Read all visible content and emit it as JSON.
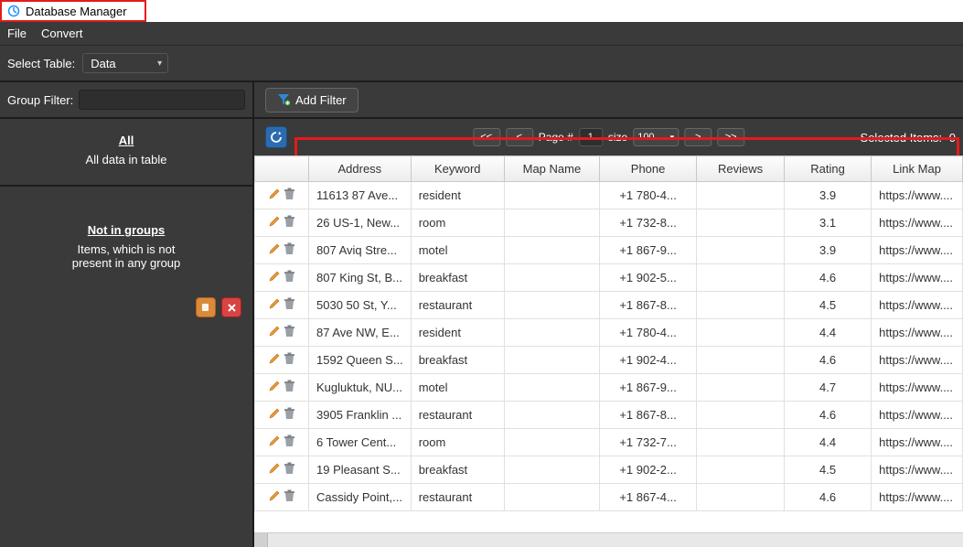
{
  "window": {
    "title": "Database Manager"
  },
  "menu": {
    "file": "File",
    "convert": "Convert"
  },
  "selectTable": {
    "label": "Select Table:",
    "value": "Data"
  },
  "sidebar": {
    "groupFilterLabel": "Group Filter:",
    "all": {
      "head": "All",
      "sub": "All data in table"
    },
    "notInGroups": {
      "head": "Not in groups",
      "sub1": "Items, which is not",
      "sub2": "present in any group"
    }
  },
  "filter": {
    "addFilter": "Add Filter"
  },
  "pager": {
    "first": "<<",
    "prev": "<",
    "pageLabel": "Page #",
    "page": "1",
    "sizeLabel": "size",
    "size": "100",
    "next": ">",
    "last": ">>"
  },
  "selected": {
    "label": "Selected Items:",
    "count": "0"
  },
  "columns": [
    "",
    "Address",
    "Keyword",
    "Map Name",
    "Phone",
    "Reviews",
    "Rating",
    "Link Map"
  ],
  "rows": [
    {
      "address": "11613 87 Ave...",
      "keyword": "resident",
      "mapname": "",
      "phone": "+1 780-4...",
      "reviews": "",
      "rating": "3.9",
      "link": "https://www...."
    },
    {
      "address": "26 US-1, New...",
      "keyword": "room",
      "mapname": "",
      "phone": "+1 732-8...",
      "reviews": "",
      "rating": "3.1",
      "link": "https://www...."
    },
    {
      "address": "807 Aviq Stre...",
      "keyword": "motel",
      "mapname": "",
      "phone": "+1 867-9...",
      "reviews": "",
      "rating": "3.9",
      "link": "https://www...."
    },
    {
      "address": "807 King St, B...",
      "keyword": "breakfast",
      "mapname": "",
      "phone": "+1 902-5...",
      "reviews": "",
      "rating": "4.6",
      "link": "https://www...."
    },
    {
      "address": "5030 50 St, Y...",
      "keyword": "restaurant",
      "mapname": "",
      "phone": "+1 867-8...",
      "reviews": "",
      "rating": "4.5",
      "link": "https://www...."
    },
    {
      "address": "87 Ave NW, E...",
      "keyword": "resident",
      "mapname": "",
      "phone": "+1 780-4...",
      "reviews": "",
      "rating": "4.4",
      "link": "https://www...."
    },
    {
      "address": "1592 Queen S...",
      "keyword": "breakfast",
      "mapname": "",
      "phone": "+1 902-4...",
      "reviews": "",
      "rating": "4.6",
      "link": "https://www...."
    },
    {
      "address": "Kugluktuk, NU...",
      "keyword": "motel",
      "mapname": "",
      "phone": "+1 867-9...",
      "reviews": "",
      "rating": "4.7",
      "link": "https://www...."
    },
    {
      "address": "3905 Franklin ...",
      "keyword": "restaurant",
      "mapname": "",
      "phone": "+1 867-8...",
      "reviews": "",
      "rating": "4.6",
      "link": "https://www...."
    },
    {
      "address": "6 Tower Cent...",
      "keyword": "room",
      "mapname": "",
      "phone": "+1 732-7...",
      "reviews": "",
      "rating": "4.4",
      "link": "https://www...."
    },
    {
      "address": "19 Pleasant S...",
      "keyword": "breakfast",
      "mapname": "",
      "phone": "+1 902-2...",
      "reviews": "",
      "rating": "4.5",
      "link": "https://www...."
    },
    {
      "address": "Cassidy Point,...",
      "keyword": "restaurant",
      "mapname": "",
      "phone": "+1 867-4...",
      "reviews": "",
      "rating": "4.6",
      "link": "https://www...."
    }
  ]
}
